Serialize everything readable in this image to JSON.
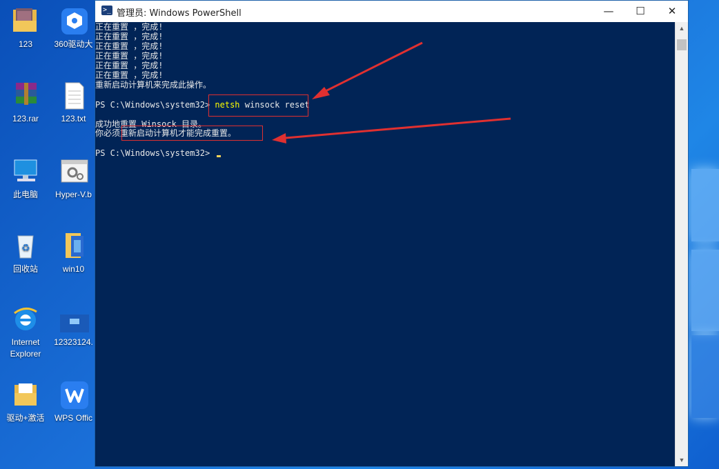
{
  "desktop": {
    "icons": [
      {
        "label": "123",
        "icon": "folder-image-icon"
      },
      {
        "label": "360驱动大",
        "icon": "driver-app-icon"
      },
      {
        "label": "123.rar",
        "icon": "rar-archive-icon"
      },
      {
        "label": "123.txt",
        "icon": "text-file-icon"
      },
      {
        "label": "此电脑",
        "icon": "computer-icon"
      },
      {
        "label": "Hyper-V.b",
        "icon": "batch-file-icon"
      },
      {
        "label": "回收站",
        "icon": "recycle-bin-icon"
      },
      {
        "label": "win10",
        "icon": "folder-icon"
      },
      {
        "label": "Internet",
        "label2": "Explorer",
        "icon": "internet-explorer-icon"
      },
      {
        "label": "12323124.",
        "icon": "image-file-icon"
      },
      {
        "label": "驱动+激活",
        "icon": "folder-icon"
      },
      {
        "label": "WPS Offic",
        "icon": "wps-office-icon"
      }
    ]
  },
  "window": {
    "title": "管理员: Windows PowerShell",
    "minimize": "—",
    "maximize": "☐",
    "close": "✕",
    "console": {
      "reset_lines": [
        "正在重置 ，完成!",
        "正在重置 ，完成!",
        "正在重置 ，完成!",
        "正在重置 ，完成!",
        "正在重置 ，完成!",
        "正在重置 ，完成!"
      ],
      "restart_msg": "重新启动计算机来完成此操作。",
      "prompt1": "PS C:\\Windows\\system32> ",
      "command_name": "netsh",
      "command_args": " winsock reset",
      "success_msg": "成功地重置 Winsock 目录。",
      "must_restart_prefix": "你必须",
      "must_restart_highlight": "重新启动计算机才能完成重置。",
      "prompt2": "PS C:\\Windows\\system32> "
    }
  },
  "colors": {
    "console_bg": "#012456",
    "annotation_red": "#e03030",
    "command_yellow": "#ffff00"
  }
}
